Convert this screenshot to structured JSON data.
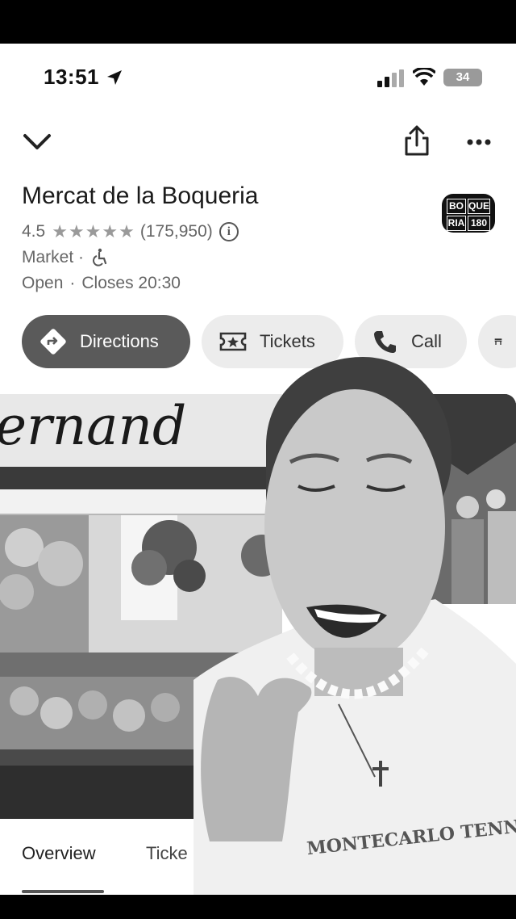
{
  "status_bar": {
    "time": "13:51",
    "battery": "34"
  },
  "header": {
    "icons": [
      "chevron-down-icon",
      "share-icon",
      "more-icon"
    ]
  },
  "place": {
    "name": "Mercat de la Boqueria",
    "rating": "4.5",
    "rating_value": 4.5,
    "stars_shown": 5,
    "review_count": "(175,950)",
    "category": "Market ·",
    "status": "Open",
    "separator": "·",
    "closes": "Closes 20:30",
    "logo": {
      "cells": [
        "BO",
        "QUE",
        "RIA",
        "180"
      ]
    }
  },
  "actions": [
    {
      "label": "Directions",
      "icon": "directions-icon"
    },
    {
      "label": "Tickets",
      "icon": "ticket-icon"
    },
    {
      "label": "Call",
      "icon": "phone-icon"
    },
    {
      "label": "",
      "icon": "store-icon"
    }
  ],
  "tabs": [
    {
      "label": "Overview",
      "selected": true
    },
    {
      "label": "Ticke",
      "selected": false
    }
  ],
  "photo": {
    "sign_text": "ernand",
    "necklace_text": "MONTECARLO TENNIS"
  },
  "colors": {
    "primary_chip": "#5a5a5a",
    "chip_bg": "#ececec",
    "sheet_bg": "#ffffff"
  }
}
